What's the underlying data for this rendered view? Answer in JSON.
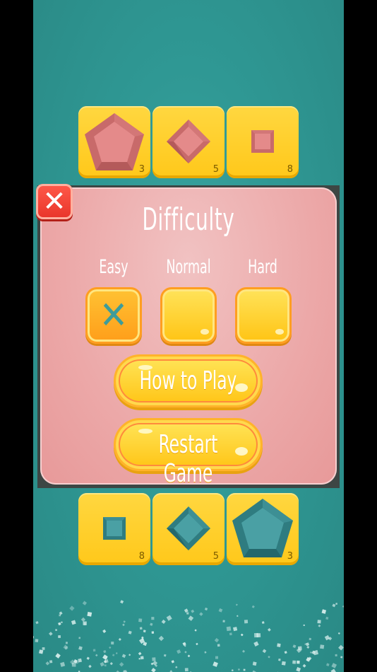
{
  "top_pieces": [
    {
      "shape": "pentagon",
      "count": "3",
      "color": "#e08080"
    },
    {
      "shape": "diamond",
      "count": "5",
      "color": "#e08080"
    },
    {
      "shape": "square",
      "count": "8",
      "color": "#e08080"
    }
  ],
  "bottom_pieces": [
    {
      "shape": "square",
      "count": "8",
      "color": "#3d8f94"
    },
    {
      "shape": "diamond",
      "count": "5",
      "color": "#3d8f94"
    },
    {
      "shape": "pentagon",
      "count": "3",
      "color": "#3d8f94"
    }
  ],
  "dialog": {
    "title": "Difficulty",
    "close_icon": "close-icon",
    "levels": [
      {
        "label": "Easy",
        "selected": true
      },
      {
        "label": "Normal",
        "selected": false
      },
      {
        "label": "Hard",
        "selected": false
      }
    ],
    "check_symbol": "✕",
    "how_to_play": "How to Play",
    "restart_game": "Restart Game"
  },
  "colors": {
    "board": "#2f9894",
    "panel": "#eca8a8",
    "tile": "#ffc81a",
    "close": "#e8342a"
  }
}
